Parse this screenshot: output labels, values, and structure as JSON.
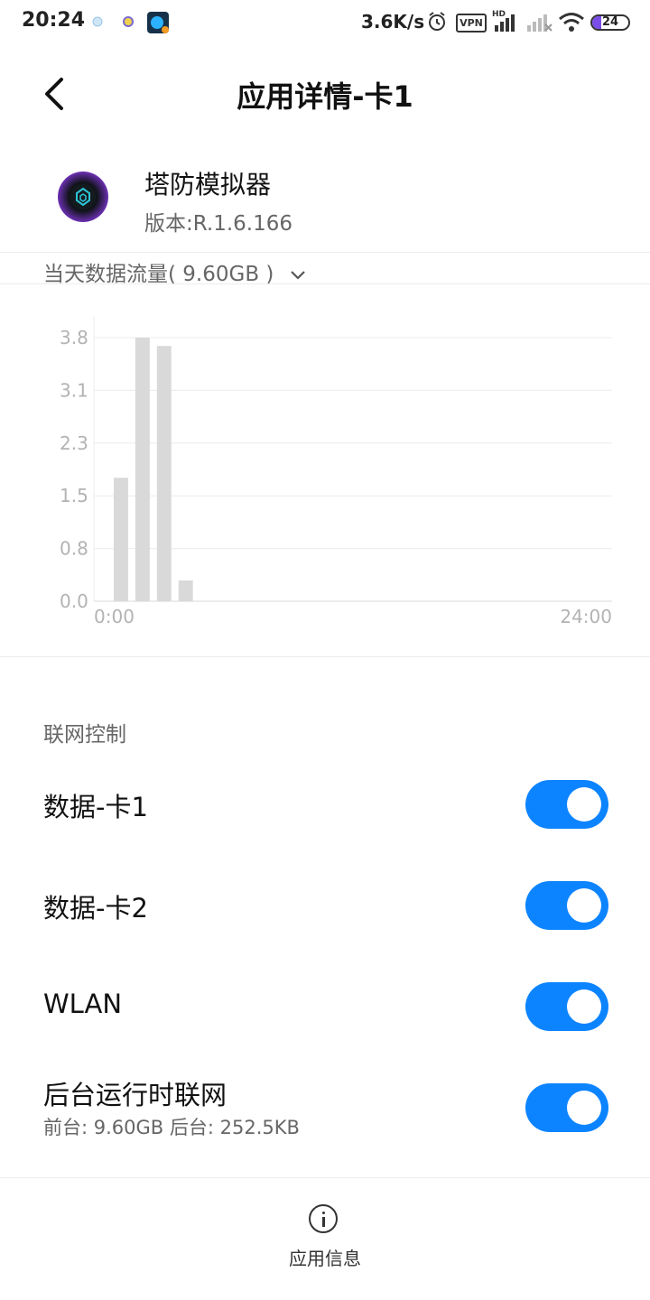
{
  "status_bar": {
    "time": "20:24",
    "net_speed": "3.6K/s",
    "vpn": "VPN",
    "hd": "HD",
    "battery": "24",
    "battery_level": 0.24,
    "icons": [
      "notification-icon",
      "notification-icon",
      "app-notification-icon",
      "alarm-icon",
      "vpn-icon",
      "signal-icon",
      "signal-no-service-icon",
      "wifi-icon",
      "battery-icon"
    ]
  },
  "header": {
    "title": "应用详情-卡1",
    "back_icon": "chevron-left-icon"
  },
  "app": {
    "name": "塔防模拟器",
    "version": "版本:R.1.6.166"
  },
  "traffic": {
    "label": "当天数据流量( 9.60GB )",
    "dropdown_icon": "chevron-down-icon"
  },
  "chart_data": {
    "type": "bar",
    "x_start_label": "0:00",
    "x_end_label": "24:00",
    "x_range": [
      0,
      24
    ],
    "yticks": [
      "0.0",
      "0.8",
      "1.5",
      "2.3",
      "3.1",
      "3.8"
    ],
    "ylim": [
      0,
      3.8
    ],
    "bar_hours": [
      1,
      2,
      3,
      4
    ],
    "values": [
      1.78,
      3.8,
      3.68,
      0.3
    ],
    "grid": true,
    "bar_color": "#d9d9d9"
  },
  "network": {
    "section_label": "联网控制",
    "rows": [
      {
        "label": "数据-卡1",
        "enabled": true
      },
      {
        "label": "数据-卡2",
        "enabled": true
      },
      {
        "label": "WLAN",
        "enabled": true
      },
      {
        "label": "后台运行时联网",
        "sub": "前台: 9.60GB  后台: 252.5KB",
        "enabled": true
      }
    ],
    "toggle_color": "#0d84ff"
  },
  "bottom": {
    "info_label": "应用信息",
    "info_icon": "info-icon"
  }
}
